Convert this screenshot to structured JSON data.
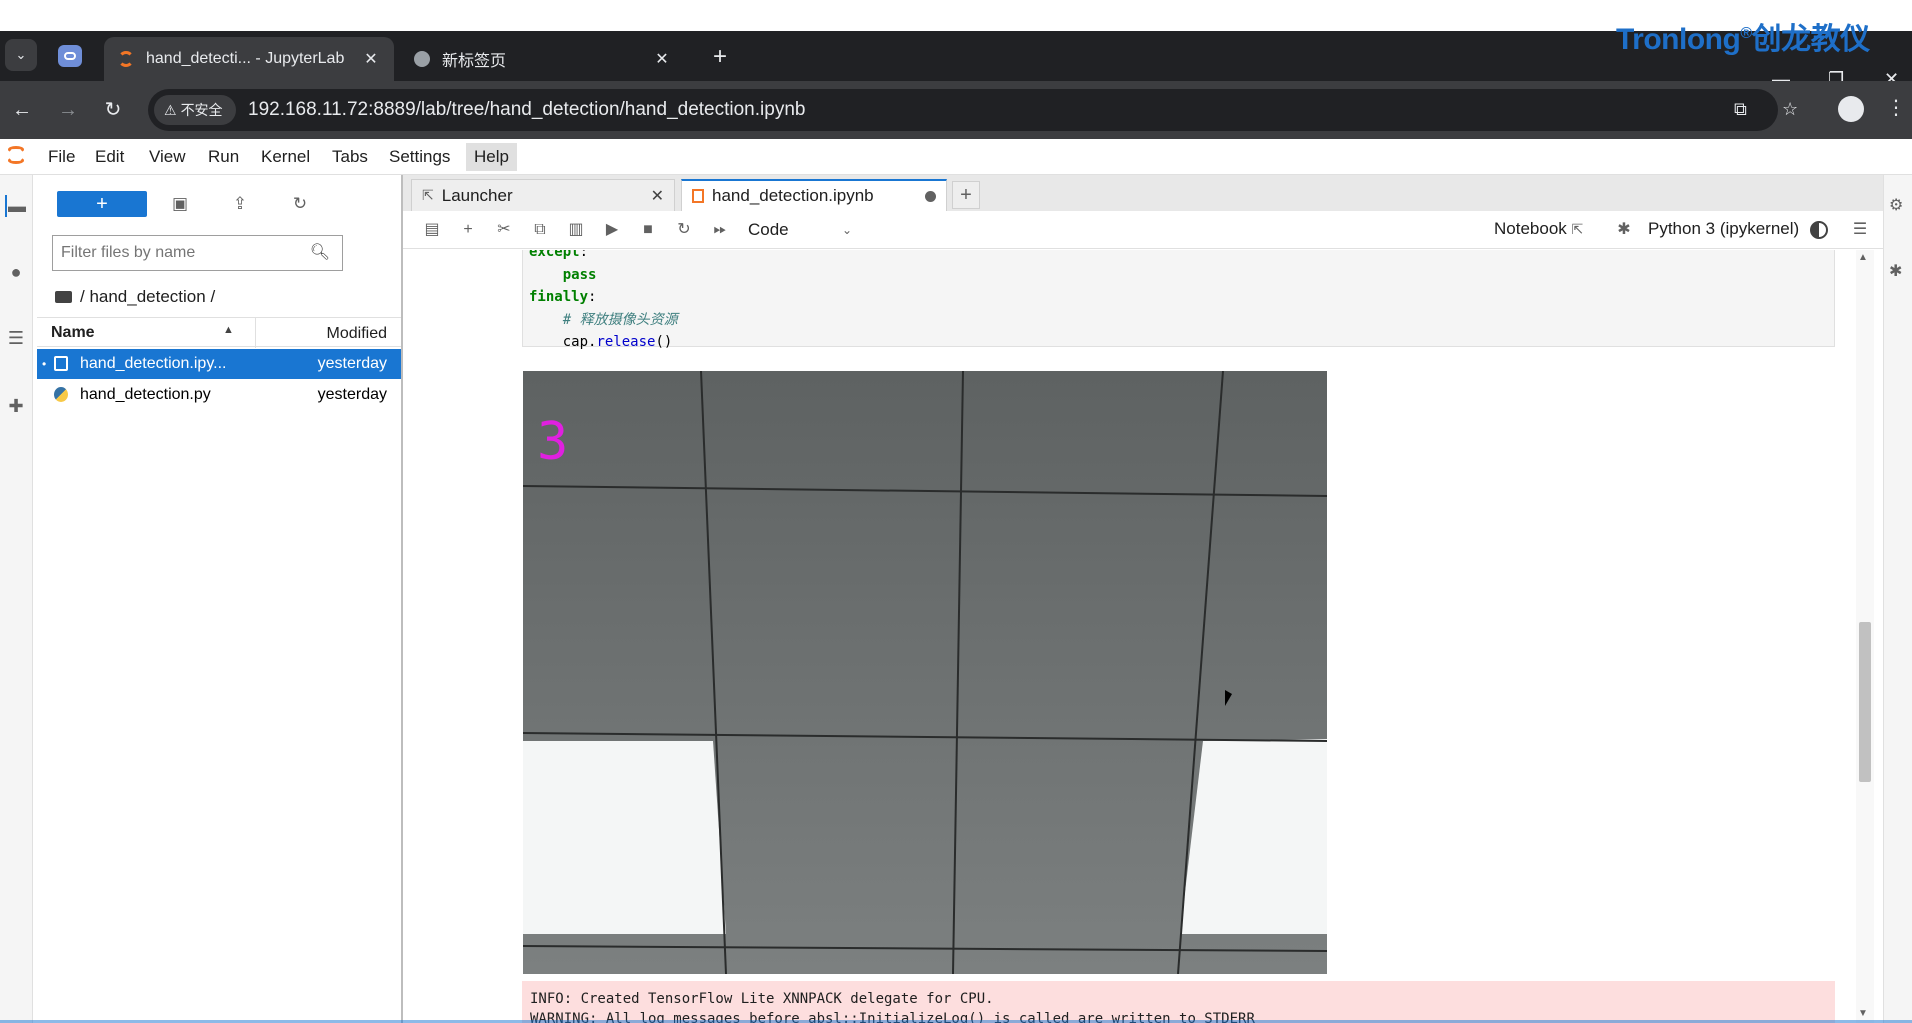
{
  "browser": {
    "tabs": [
      {
        "title": "hand_detecti... - JupyterLab",
        "close": "✕"
      },
      {
        "title": "新标签页",
        "close": "✕"
      }
    ],
    "new_tab": "+",
    "insecure_label": "不安全",
    "url": "192.168.11.72:8889/lab/tree/hand_detection/hand_detection.ipynb"
  },
  "brand": {
    "name": "Tronlong",
    "registered": "®",
    "cn": "创龙教仪",
    "color": "#1e6fc8"
  },
  "menu": [
    "File",
    "Edit",
    "View",
    "Run",
    "Kernel",
    "Tabs",
    "Settings",
    "Help"
  ],
  "filebrowser": {
    "new_label": "+",
    "filter_placeholder": "Filter files by name",
    "breadcrumb": "/ hand_detection /",
    "col_name": "Name",
    "col_modified": "Modified",
    "files": [
      {
        "name": "hand_detection.ipy...",
        "modified": "yesterday",
        "selected": true,
        "dot": "•"
      },
      {
        "name": "hand_detection.py",
        "modified": "yesterday",
        "selected": false
      }
    ]
  },
  "dock": {
    "tabs": [
      {
        "label": "Launcher",
        "close": "✕"
      },
      {
        "label": "hand_detection.ipynb"
      }
    ],
    "add": "+"
  },
  "toolbar": {
    "cell_type": "Code",
    "notebook_label": "Notebook",
    "kernel": "Python 3 (ipykernel)"
  },
  "cell": {
    "lines": [
      {
        "kw": "except",
        "rest": ":"
      },
      {
        "indent": "    ",
        "kw": "pass"
      },
      {
        "kw": "finally",
        "rest": ":"
      },
      {
        "indent": "    ",
        "comment": "# 释放摄像头资源"
      },
      {
        "indent": "    ",
        "pre": "cap.",
        "fn": "release",
        "post": "()"
      }
    ]
  },
  "output": {
    "overlay_text": "3",
    "overlay_color": "#e020e0",
    "stderr_lines": [
      "INFO: Created TensorFlow Lite XNNPACK delegate for CPU.",
      "WARNING: All log messages before absl::InitializeLog() is called are written to STDERR"
    ]
  },
  "colors": {
    "accent": "#1976d2",
    "jupyter_orange": "#f37626",
    "stderr_bg": "#fddede"
  }
}
